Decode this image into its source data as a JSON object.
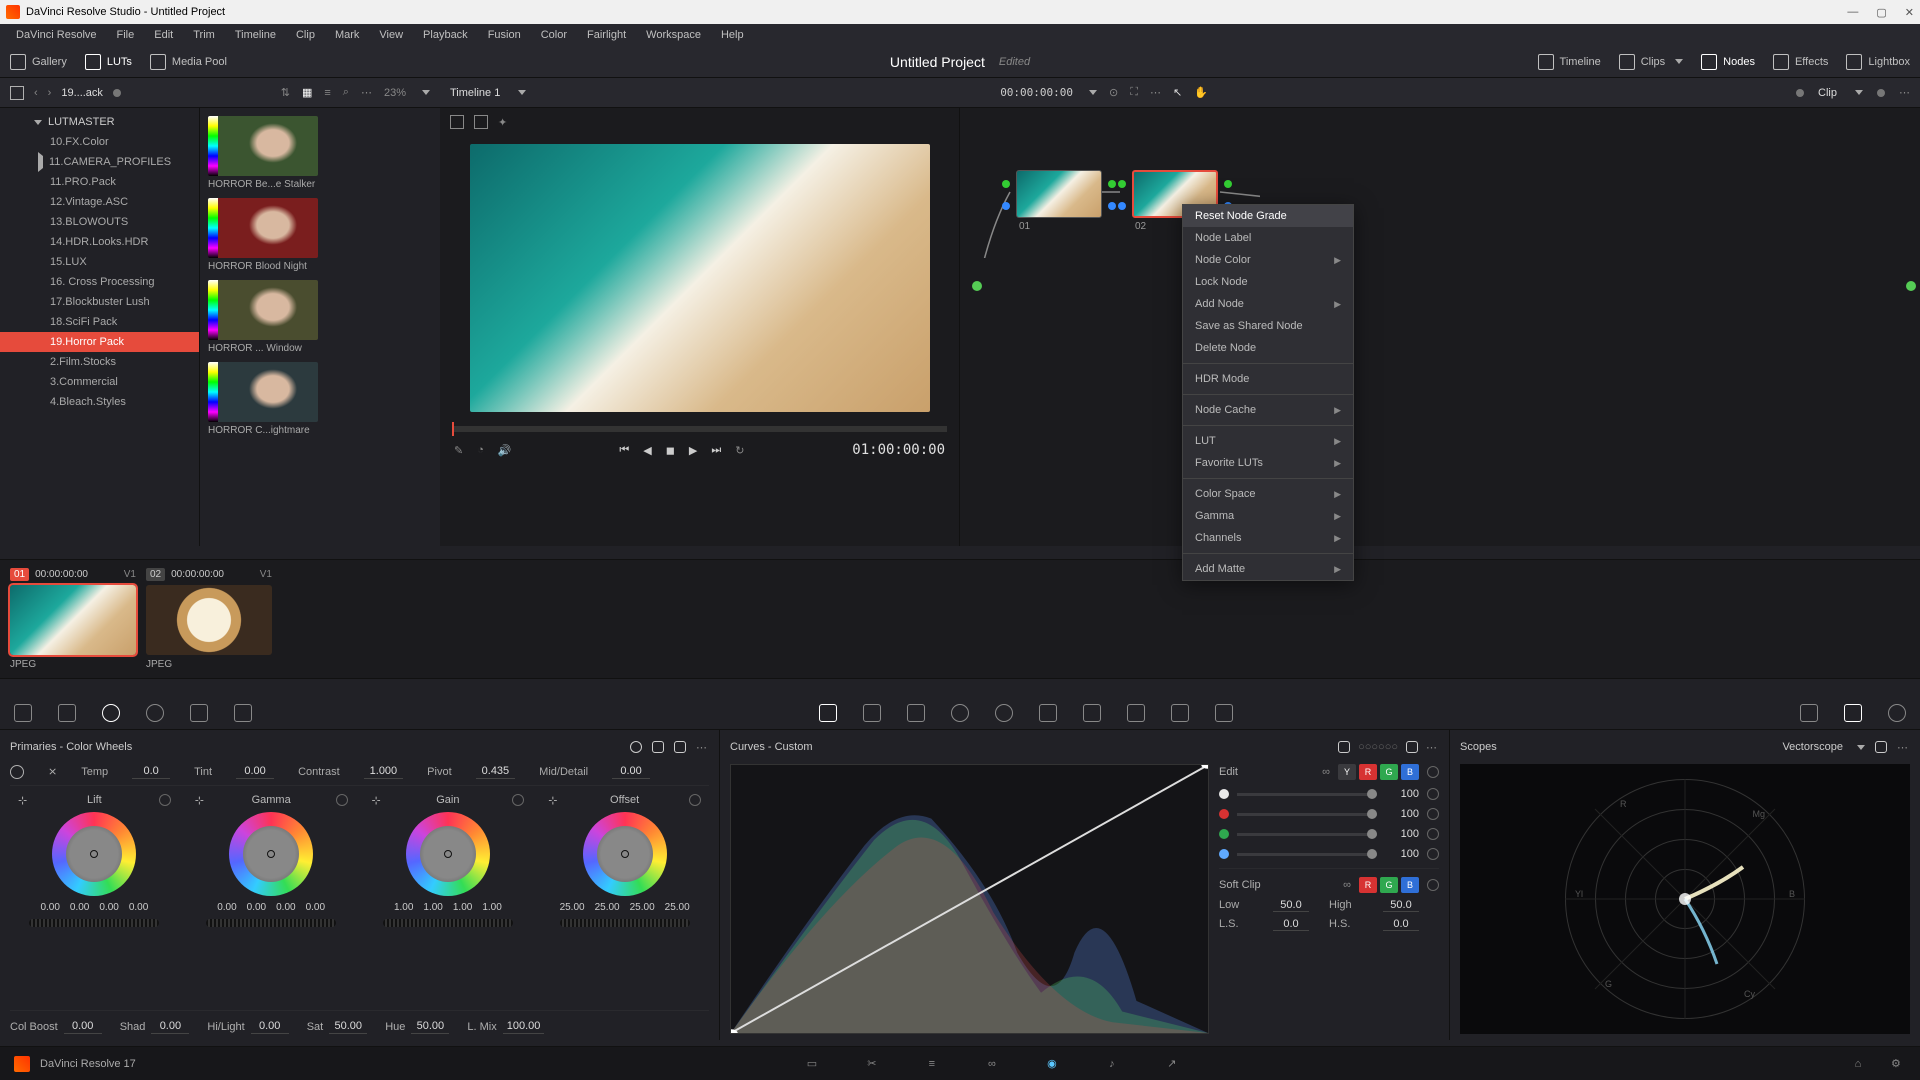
{
  "window": {
    "title": "DaVinci Resolve Studio - Untitled Project"
  },
  "menu": [
    "DaVinci Resolve",
    "File",
    "Edit",
    "Trim",
    "Timeline",
    "Clip",
    "Mark",
    "View",
    "Playback",
    "Fusion",
    "Color",
    "Fairlight",
    "Workspace",
    "Help"
  ],
  "top_toolbar": {
    "left": [
      {
        "id": "gallery",
        "label": "Gallery"
      },
      {
        "id": "luts",
        "label": "LUTs",
        "active": true
      },
      {
        "id": "mediapool",
        "label": "Media Pool"
      }
    ],
    "right": [
      {
        "id": "timeline",
        "label": "Timeline"
      },
      {
        "id": "clips",
        "label": "Clips",
        "dropdown": true
      },
      {
        "id": "nodes",
        "label": "Nodes",
        "active": true
      },
      {
        "id": "effects",
        "label": "Effects"
      },
      {
        "id": "lightbox",
        "label": "Lightbox"
      }
    ]
  },
  "project": {
    "name": "Untitled Project",
    "status": "Edited"
  },
  "subheader": {
    "breadcrumb": "19....ack",
    "zoom": "23%",
    "timeline_name": "Timeline 1",
    "timeline_tc": "00:00:00:00",
    "node_mode": "Clip"
  },
  "lut_tree": {
    "root": "LUTMASTER",
    "items": [
      "10.FX.Color",
      "11.CAMERA_PROFILES",
      "11.PRO.Pack",
      "12.Vintage.ASC",
      "13.BLOWOUTS",
      "14.HDR.Looks.HDR",
      "15.LUX",
      "16. Cross Processing",
      "17.Blockbuster Lush",
      "18.SciFi Pack",
      "19.Horror Pack",
      "2.Film.Stocks",
      "3.Commercial",
      "4.Bleach.Styles"
    ],
    "selected_index": 10
  },
  "lut_thumbs": [
    {
      "label": "HORROR Be...e Stalker",
      "tint": "#3b5530"
    },
    {
      "label": "HORROR Blood Night",
      "tint": "#7a1e1e"
    },
    {
      "label": "HORROR ... Window",
      "tint": "#4a4d2f"
    },
    {
      "label": "HORROR C...ightmare",
      "tint": "#2c3a3e"
    }
  ],
  "viewer": {
    "tc": "01:00:00:00"
  },
  "nodes": {
    "items": [
      {
        "id": "01"
      },
      {
        "id": "02"
      }
    ]
  },
  "context_menu": [
    {
      "label": "Reset Node Grade",
      "hl": true
    },
    {
      "label": "Node Label"
    },
    {
      "label": "Node Color",
      "sub": true
    },
    {
      "label": "Lock Node"
    },
    {
      "label": "Add Node",
      "sub": true
    },
    {
      "label": "Save as Shared Node"
    },
    {
      "label": "Delete Node"
    },
    {
      "sep": true
    },
    {
      "label": "HDR Mode"
    },
    {
      "sep": true
    },
    {
      "label": "Node Cache",
      "sub": true
    },
    {
      "sep": true
    },
    {
      "label": "LUT",
      "sub": true
    },
    {
      "label": "Favorite LUTs",
      "sub": true
    },
    {
      "sep": true
    },
    {
      "label": "Color Space",
      "sub": true
    },
    {
      "label": "Gamma",
      "sub": true
    },
    {
      "label": "Channels",
      "sub": true
    },
    {
      "sep": true
    },
    {
      "label": "Add Matte",
      "sub": true
    }
  ],
  "clips": [
    {
      "index": "01",
      "tc": "00:00:00:00",
      "track": "V1",
      "format": "JPEG",
      "selected": true,
      "kind": "beach"
    },
    {
      "index": "02",
      "tc": "00:00:00:00",
      "track": "V1",
      "format": "JPEG",
      "selected": false,
      "kind": "coffee"
    }
  ],
  "primaries": {
    "title": "Primaries - Color Wheels",
    "params": {
      "temp_label": "Temp",
      "temp": "0.0",
      "tint_label": "Tint",
      "tint": "0.00",
      "contrast_label": "Contrast",
      "contrast": "1.000",
      "pivot_label": "Pivot",
      "pivot": "0.435",
      "middetail_label": "Mid/Detail",
      "middetail": "0.00"
    },
    "wheels": [
      {
        "name": "Lift",
        "vals": [
          "0.00",
          "0.00",
          "0.00",
          "0.00"
        ]
      },
      {
        "name": "Gamma",
        "vals": [
          "0.00",
          "0.00",
          "0.00",
          "0.00"
        ]
      },
      {
        "name": "Gain",
        "vals": [
          "1.00",
          "1.00",
          "1.00",
          "1.00"
        ]
      },
      {
        "name": "Offset",
        "vals": [
          "25.00",
          "25.00",
          "25.00",
          "25.00"
        ]
      }
    ],
    "bottom": {
      "colboost_label": "Col Boost",
      "colboost": "0.00",
      "shad_label": "Shad",
      "shad": "0.00",
      "hilight_label": "Hi/Light",
      "hilight": "0.00",
      "sat_label": "Sat",
      "sat": "50.00",
      "hue_label": "Hue",
      "hue": "50.00",
      "lmix_label": "L. Mix",
      "lmix": "100.00"
    }
  },
  "curves": {
    "title": "Curves - Custom",
    "edit_label": "Edit",
    "channels": [
      {
        "color": "#e8e8e8",
        "value": "100"
      },
      {
        "color": "#d73232",
        "value": "100"
      },
      {
        "color": "#2fa84f",
        "value": "100"
      },
      {
        "color": "#60aaff",
        "value": "100"
      }
    ],
    "softclip_label": "Soft Clip",
    "softclip": {
      "low_label": "Low",
      "low": "50.0",
      "high_label": "High",
      "high": "50.0",
      "ls_label": "L.S.",
      "ls": "0.0",
      "hs_label": "H.S.",
      "hs": "0.0"
    }
  },
  "scopes": {
    "title": "Scopes",
    "mode": "Vectorscope"
  },
  "footer": {
    "version": "DaVinci Resolve 17"
  }
}
